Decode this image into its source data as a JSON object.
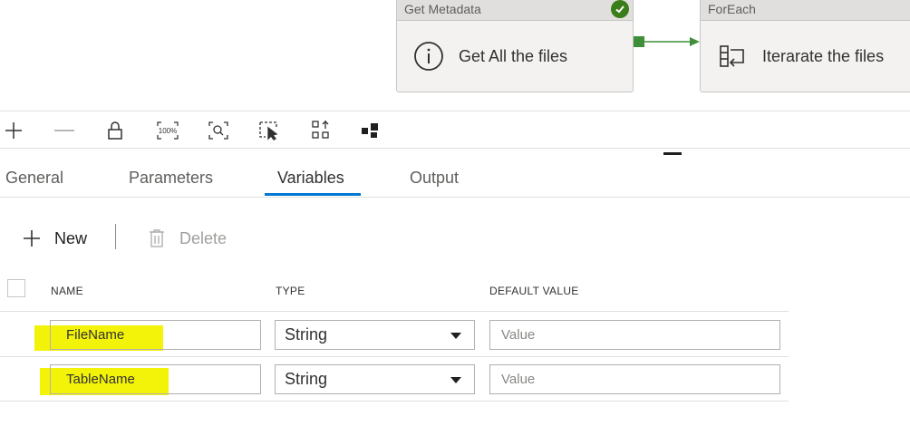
{
  "pipeline": {
    "activities": [
      {
        "header": "Get Metadata",
        "name": "Get All the files",
        "icon": "info-icon",
        "status": "success"
      },
      {
        "header": "ForEach",
        "name": "Iterarate the files",
        "icon": "foreach-icon"
      }
    ]
  },
  "toolbar": {
    "icons": [
      "zoom-in-icon",
      "zoom-out-icon",
      "lock-icon",
      "zoom-100-icon",
      "zoom-fit-icon",
      "select-icon",
      "auto-align-icon",
      "layout-icon"
    ],
    "zoom_100_label": "100%"
  },
  "tabs": [
    "General",
    "Parameters",
    "Variables",
    "Output"
  ],
  "active_tab": "Variables",
  "commands": {
    "new_label": "New",
    "delete_label": "Delete"
  },
  "grid": {
    "columns": [
      "NAME",
      "TYPE",
      "DEFAULT VALUE"
    ],
    "rows": [
      {
        "name": "FileName",
        "type": "String",
        "default_placeholder": "Value"
      },
      {
        "name": "TableName",
        "type": "String",
        "default_placeholder": "Value"
      }
    ]
  },
  "colors": {
    "accent": "#0078d4",
    "success": "#3a7d1a",
    "connector": "#3f8f3a",
    "highlight": "#f3f30a"
  }
}
